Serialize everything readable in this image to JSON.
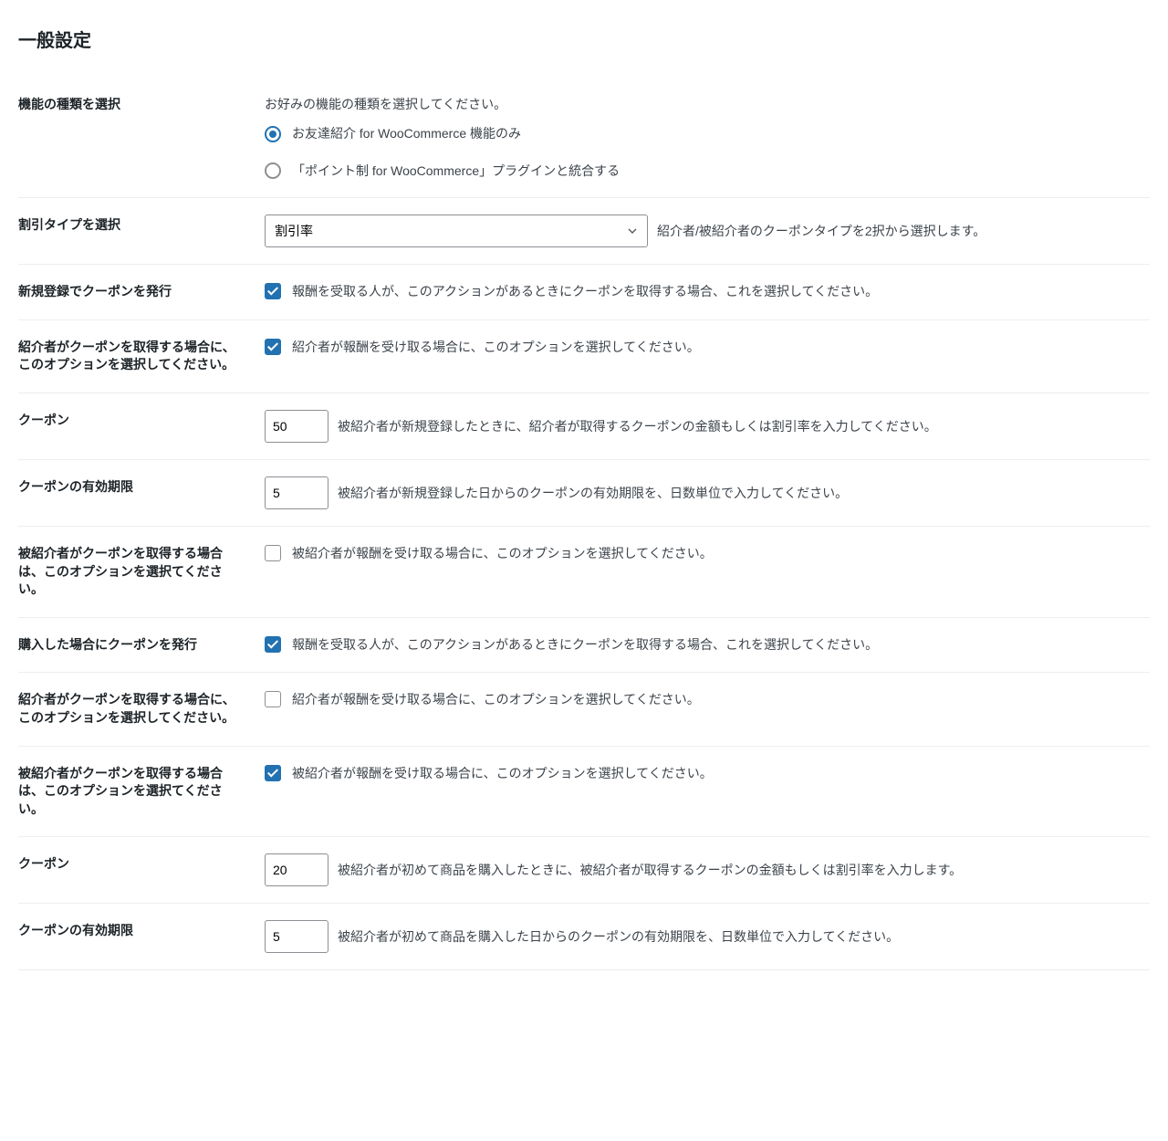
{
  "section_title": "一般設定",
  "rows": {
    "feature_type": {
      "label": "機能の種類を選択",
      "description": "お好みの機能の種類を選択してください。",
      "option1": "お友達紹介 for WooCommerce 機能のみ",
      "option2": "「ポイント制 for WooCommerce」プラグインと統合する"
    },
    "discount_type": {
      "label": "割引タイプを選択",
      "selected": "割引率",
      "description": "紹介者/被紹介者のクーポンタイプを2択から選択します。"
    },
    "signup_coupon": {
      "label": "新規登録でクーポンを発行",
      "description": "報酬を受取る人が、このアクションがあるときにクーポンを取得する場合、これを選択してください。"
    },
    "referrer_coupon_signup": {
      "label": "紹介者がクーポンを取得する場合に、このオプションを選択してください。",
      "description": "紹介者が報酬を受け取る場合に、このオプションを選択してください。"
    },
    "coupon_value_1": {
      "label": "クーポン",
      "value": "50",
      "description": "被紹介者が新規登録したときに、紹介者が取得するクーポンの金額もしくは割引率を入力してください。"
    },
    "coupon_expiry_1": {
      "label": "クーポンの有効期限",
      "value": "5",
      "description": "被紹介者が新規登録した日からのクーポンの有効期限を、日数単位で入力してください。"
    },
    "referee_coupon_signup": {
      "label": "被紹介者がクーポンを取得する場合は、このオプションを選択てください。",
      "description": "被紹介者が報酬を受け取る場合に、このオプションを選択してください。"
    },
    "purchase_coupon": {
      "label": "購入した場合にクーポンを発行",
      "description": "報酬を受取る人が、このアクションがあるときにクーポンを取得する場合、これを選択してください。"
    },
    "referrer_coupon_purchase": {
      "label": "紹介者がクーポンを取得する場合に、このオプションを選択してください。",
      "description": "紹介者が報酬を受け取る場合に、このオプションを選択してください。"
    },
    "referee_coupon_purchase": {
      "label": "被紹介者がクーポンを取得する場合は、このオプションを選択てください。",
      "description": "被紹介者が報酬を受け取る場合に、このオプションを選択してください。"
    },
    "coupon_value_2": {
      "label": "クーポン",
      "value": "20",
      "description": "被紹介者が初めて商品を購入したときに、被紹介者が取得するクーポンの金額もしくは割引率を入力します。"
    },
    "coupon_expiry_2": {
      "label": "クーポンの有効期限",
      "value": "5",
      "description": "被紹介者が初めて商品を購入した日からのクーポンの有効期限を、日数単位で入力してください。"
    }
  }
}
